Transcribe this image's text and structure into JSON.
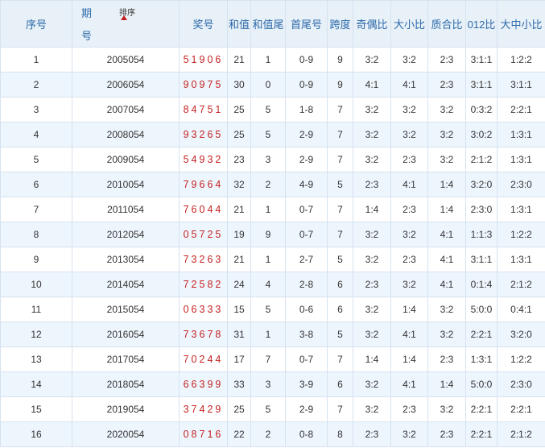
{
  "header": {
    "seq": "序号",
    "period_top": "期",
    "period_bottom": "号",
    "sort": "排序",
    "award": "奖号",
    "sum": "和值",
    "sum_tail": "和值尾",
    "head_tail": "首尾号",
    "span": "跨度",
    "odd_even": "奇偶比",
    "big_small": "大小比",
    "prime_composite": "质合比",
    "ratio_012": "012比",
    "big_mid_small": "大中小比"
  },
  "rows": [
    {
      "seq": "1",
      "period": "2005054",
      "award": "51906",
      "sum": "21",
      "sum_tail": "1",
      "head_tail": "0-9",
      "span": "9",
      "odd_even": "3:2",
      "big_small": "3:2",
      "prime_composite": "2:3",
      "r012": "3:1:1",
      "bms": "1:2:2"
    },
    {
      "seq": "2",
      "period": "2006054",
      "award": "90975",
      "sum": "30",
      "sum_tail": "0",
      "head_tail": "0-9",
      "span": "9",
      "odd_even": "4:1",
      "big_small": "4:1",
      "prime_composite": "2:3",
      "r012": "3:1:1",
      "bms": "3:1:1"
    },
    {
      "seq": "3",
      "period": "2007054",
      "award": "84751",
      "sum": "25",
      "sum_tail": "5",
      "head_tail": "1-8",
      "span": "7",
      "odd_even": "3:2",
      "big_small": "3:2",
      "prime_composite": "3:2",
      "r012": "0:3:2",
      "bms": "2:2:1"
    },
    {
      "seq": "4",
      "period": "2008054",
      "award": "93265",
      "sum": "25",
      "sum_tail": "5",
      "head_tail": "2-9",
      "span": "7",
      "odd_even": "3:2",
      "big_small": "3:2",
      "prime_composite": "3:2",
      "r012": "3:0:2",
      "bms": "1:3:1"
    },
    {
      "seq": "5",
      "period": "2009054",
      "award": "54932",
      "sum": "23",
      "sum_tail": "3",
      "head_tail": "2-9",
      "span": "7",
      "odd_even": "3:2",
      "big_small": "2:3",
      "prime_composite": "3:2",
      "r012": "2:1:2",
      "bms": "1:3:1"
    },
    {
      "seq": "6",
      "period": "2010054",
      "award": "79664",
      "sum": "32",
      "sum_tail": "2",
      "head_tail": "4-9",
      "span": "5",
      "odd_even": "2:3",
      "big_small": "4:1",
      "prime_composite": "1:4",
      "r012": "3:2:0",
      "bms": "2:3:0"
    },
    {
      "seq": "7",
      "period": "2011054",
      "award": "76044",
      "sum": "21",
      "sum_tail": "1",
      "head_tail": "0-7",
      "span": "7",
      "odd_even": "1:4",
      "big_small": "2:3",
      "prime_composite": "1:4",
      "r012": "2:3:0",
      "bms": "1:3:1"
    },
    {
      "seq": "8",
      "period": "2012054",
      "award": "05725",
      "sum": "19",
      "sum_tail": "9",
      "head_tail": "0-7",
      "span": "7",
      "odd_even": "3:2",
      "big_small": "3:2",
      "prime_composite": "4:1",
      "r012": "1:1:3",
      "bms": "1:2:2"
    },
    {
      "seq": "9",
      "period": "2013054",
      "award": "73263",
      "sum": "21",
      "sum_tail": "1",
      "head_tail": "2-7",
      "span": "5",
      "odd_even": "3:2",
      "big_small": "2:3",
      "prime_composite": "4:1",
      "r012": "3:1:1",
      "bms": "1:3:1"
    },
    {
      "seq": "10",
      "period": "2014054",
      "award": "72582",
      "sum": "24",
      "sum_tail": "4",
      "head_tail": "2-8",
      "span": "6",
      "odd_even": "2:3",
      "big_small": "3:2",
      "prime_composite": "4:1",
      "r012": "0:1:4",
      "bms": "2:1:2"
    },
    {
      "seq": "11",
      "period": "2015054",
      "award": "06333",
      "sum": "15",
      "sum_tail": "5",
      "head_tail": "0-6",
      "span": "6",
      "odd_even": "3:2",
      "big_small": "1:4",
      "prime_composite": "3:2",
      "r012": "5:0:0",
      "bms": "0:4:1"
    },
    {
      "seq": "12",
      "period": "2016054",
      "award": "73678",
      "sum": "31",
      "sum_tail": "1",
      "head_tail": "3-8",
      "span": "5",
      "odd_even": "3:2",
      "big_small": "4:1",
      "prime_composite": "3:2",
      "r012": "2:2:1",
      "bms": "3:2:0"
    },
    {
      "seq": "13",
      "period": "2017054",
      "award": "70244",
      "sum": "17",
      "sum_tail": "7",
      "head_tail": "0-7",
      "span": "7",
      "odd_even": "1:4",
      "big_small": "1:4",
      "prime_composite": "2:3",
      "r012": "1:3:1",
      "bms": "1:2:2"
    },
    {
      "seq": "14",
      "period": "2018054",
      "award": "66399",
      "sum": "33",
      "sum_tail": "3",
      "head_tail": "3-9",
      "span": "6",
      "odd_even": "3:2",
      "big_small": "4:1",
      "prime_composite": "1:4",
      "r012": "5:0:0",
      "bms": "2:3:0"
    },
    {
      "seq": "15",
      "period": "2019054",
      "award": "37429",
      "sum": "25",
      "sum_tail": "5",
      "head_tail": "2-9",
      "span": "7",
      "odd_even": "3:2",
      "big_small": "2:3",
      "prime_composite": "3:2",
      "r012": "2:2:1",
      "bms": "2:2:1"
    },
    {
      "seq": "16",
      "period": "2020054",
      "award": "08716",
      "sum": "22",
      "sum_tail": "2",
      "head_tail": "0-8",
      "span": "8",
      "odd_even": "2:3",
      "big_small": "3:2",
      "prime_composite": "2:3",
      "r012": "2:2:1",
      "bms": "2:1:2"
    }
  ]
}
